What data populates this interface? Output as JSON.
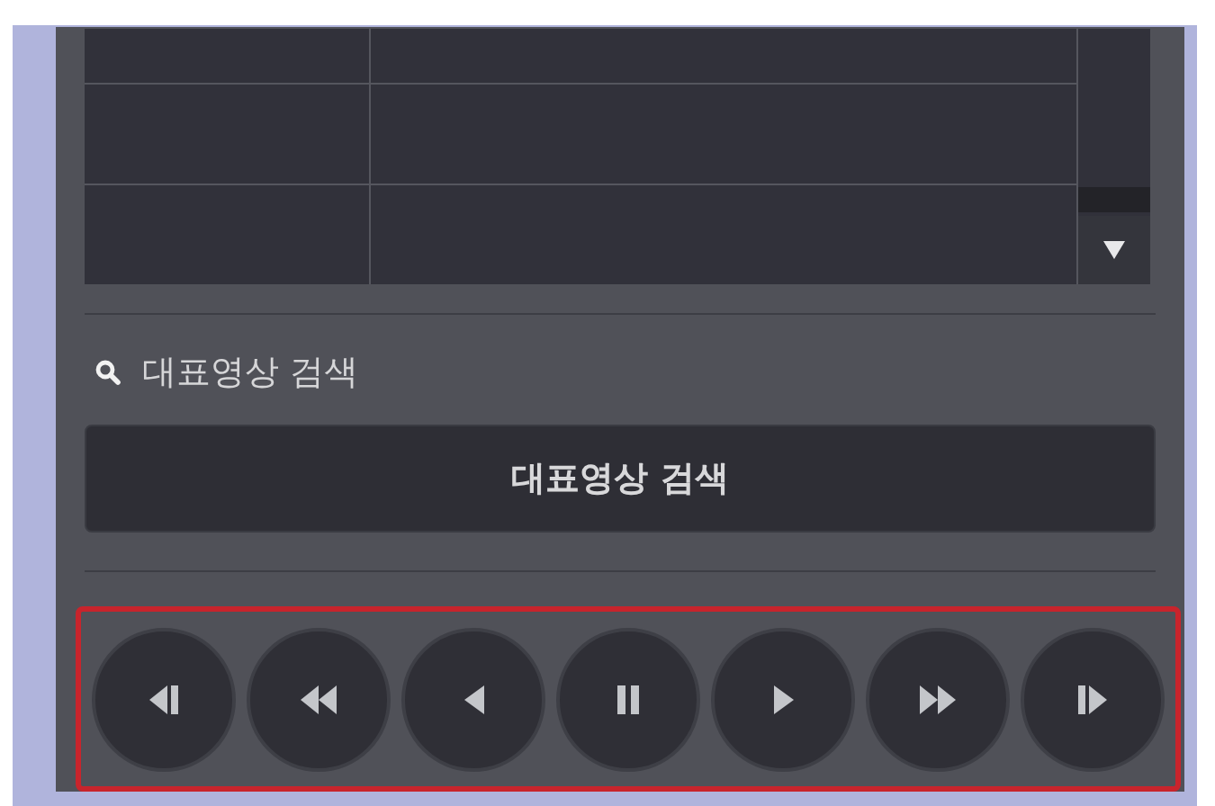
{
  "search_section": {
    "label": "대표영상 검색",
    "button": "대표영상 검색"
  },
  "playback_controls": {
    "highlighted": true,
    "buttons": [
      {
        "kind": "step-back"
      },
      {
        "kind": "rewind"
      },
      {
        "kind": "reverse"
      },
      {
        "kind": "pause"
      },
      {
        "kind": "play"
      },
      {
        "kind": "fast-forward"
      },
      {
        "kind": "step-forward"
      }
    ]
  }
}
